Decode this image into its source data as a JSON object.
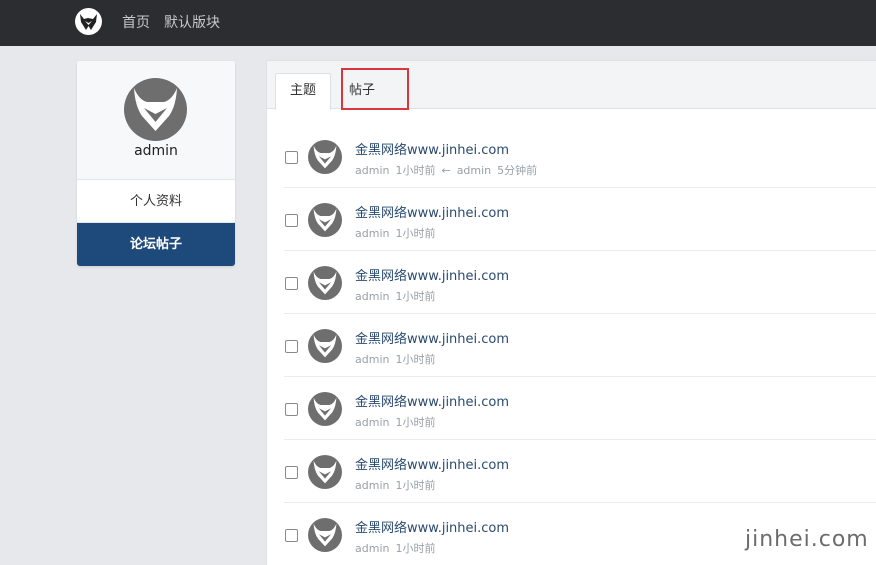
{
  "nav": {
    "home": "首页",
    "board": "默认版块"
  },
  "sidebar": {
    "username": "admin",
    "items": [
      {
        "label": "个人资料"
      },
      {
        "label": "论坛帖子"
      }
    ]
  },
  "tabs": [
    {
      "label": "主题"
    },
    {
      "label": "帖子"
    }
  ],
  "posts": [
    {
      "title": "金黑网络www.jinhei.com",
      "author": "admin",
      "time": "1小时前",
      "arrow": "←",
      "last_author": "admin",
      "last_time": "5分钟前"
    },
    {
      "title": "金黑网络www.jinhei.com",
      "author": "admin",
      "time": "1小时前"
    },
    {
      "title": "金黑网络www.jinhei.com",
      "author": "admin",
      "time": "1小时前"
    },
    {
      "title": "金黑网络www.jinhei.com",
      "author": "admin",
      "time": "1小时前"
    },
    {
      "title": "金黑网络www.jinhei.com",
      "author": "admin",
      "time": "1小时前"
    },
    {
      "title": "金黑网络www.jinhei.com",
      "author": "admin",
      "time": "1小时前"
    },
    {
      "title": "金黑网络www.jinhei.com",
      "author": "admin",
      "time": "1小时前"
    }
  ],
  "watermark": "jinhei.com",
  "colors": {
    "topbar": "#2b2d31",
    "active_nav": "#1e4a7b",
    "highlight": "#d9363e"
  }
}
